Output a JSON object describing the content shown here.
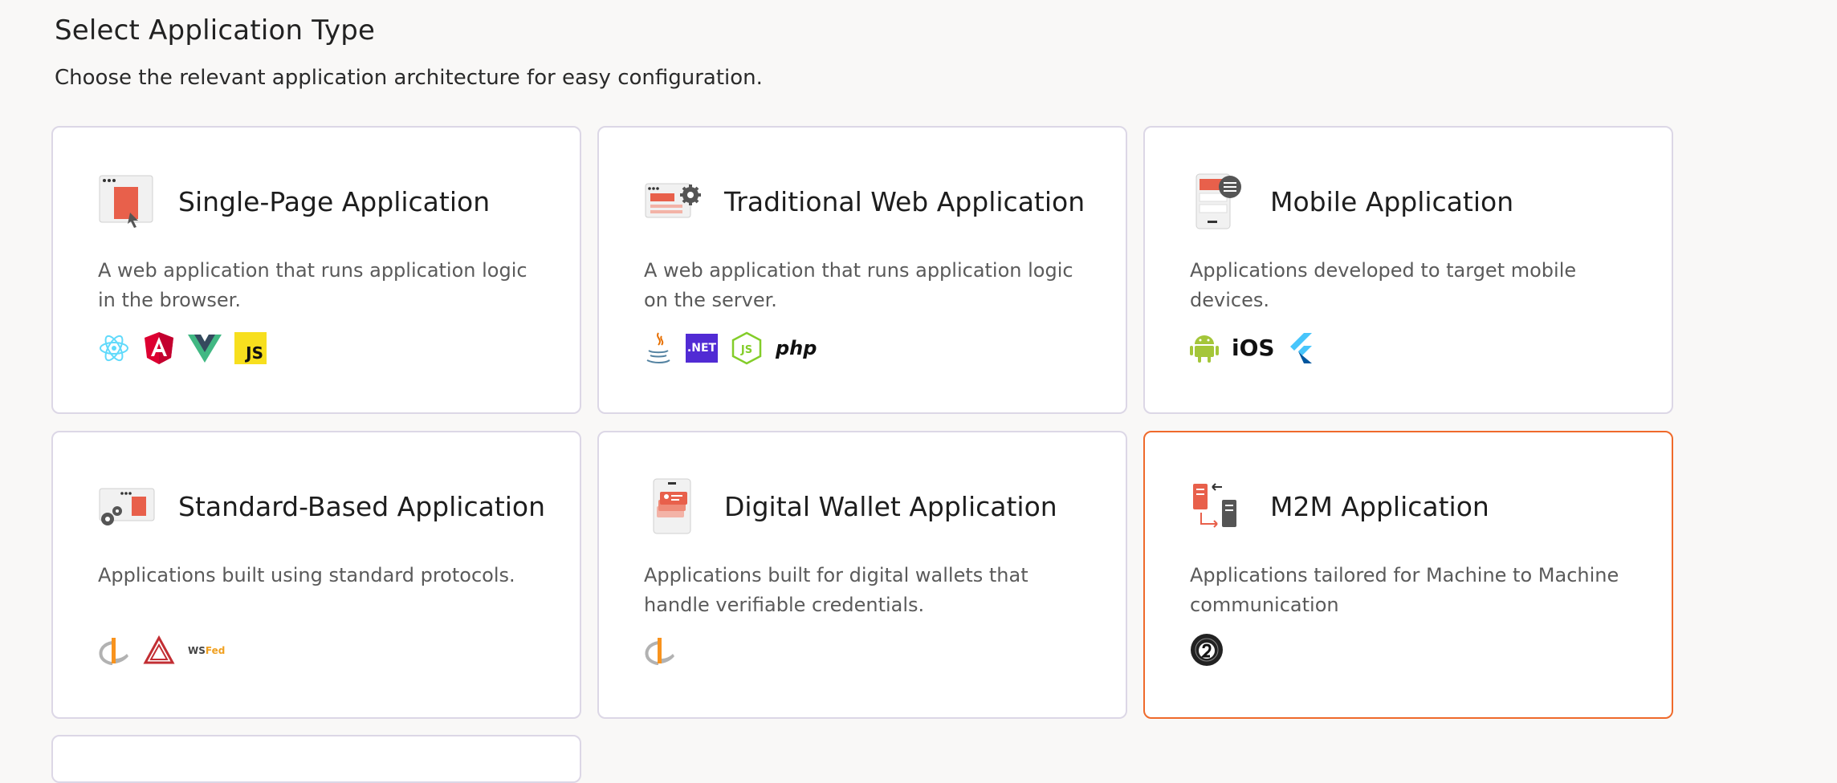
{
  "header": {
    "title": "Select Application Type",
    "subtitle": "Choose the relevant application architecture for easy configuration."
  },
  "cards": [
    {
      "title": "Single-Page Application",
      "description": "A web application that runs application logic in the browser.",
      "icon": "single-page-app-icon",
      "technologies": [
        "react-icon",
        "angular-icon",
        "vue-icon",
        "javascript-icon"
      ],
      "selected": false
    },
    {
      "title": "Traditional Web Application",
      "description": "A web application that runs application logic on the server.",
      "icon": "traditional-web-app-icon",
      "technologies": [
        "java-icon",
        "dotnet-icon",
        "nodejs-icon",
        "php-icon"
      ],
      "tech_labels": {
        "dotnet": ".NET",
        "php": "php"
      },
      "selected": false
    },
    {
      "title": "Mobile Application",
      "description": "Applications developed to target mobile devices.",
      "icon": "mobile-app-icon",
      "technologies": [
        "android-icon",
        "ios-icon",
        "flutter-icon"
      ],
      "tech_labels": {
        "ios": "iOS"
      },
      "selected": false
    },
    {
      "title": "Standard-Based Application",
      "description": "Applications built using standard protocols.",
      "icon": "standard-based-app-icon",
      "technologies": [
        "openid-icon",
        "saml-icon",
        "wsfed-icon"
      ],
      "tech_labels": {
        "wsfed_ws": "WS",
        "wsfed_fed": "Fed"
      },
      "selected": false
    },
    {
      "title": "Digital Wallet Application",
      "description": "Applications built for digital wallets that handle verifiable credentials.",
      "icon": "digital-wallet-app-icon",
      "technologies": [
        "openid-icon"
      ],
      "selected": false
    },
    {
      "title": "M2M Application",
      "description": "Applications tailored for Machine to Machine communication",
      "icon": "m2m-app-icon",
      "technologies": [
        "oauth2-icon"
      ],
      "selected": true
    }
  ],
  "colors": {
    "background": "#f9f8f7",
    "card_border": "#dcd7e6",
    "selected_border": "#ef6a2b",
    "accent_red": "#e8604b"
  }
}
